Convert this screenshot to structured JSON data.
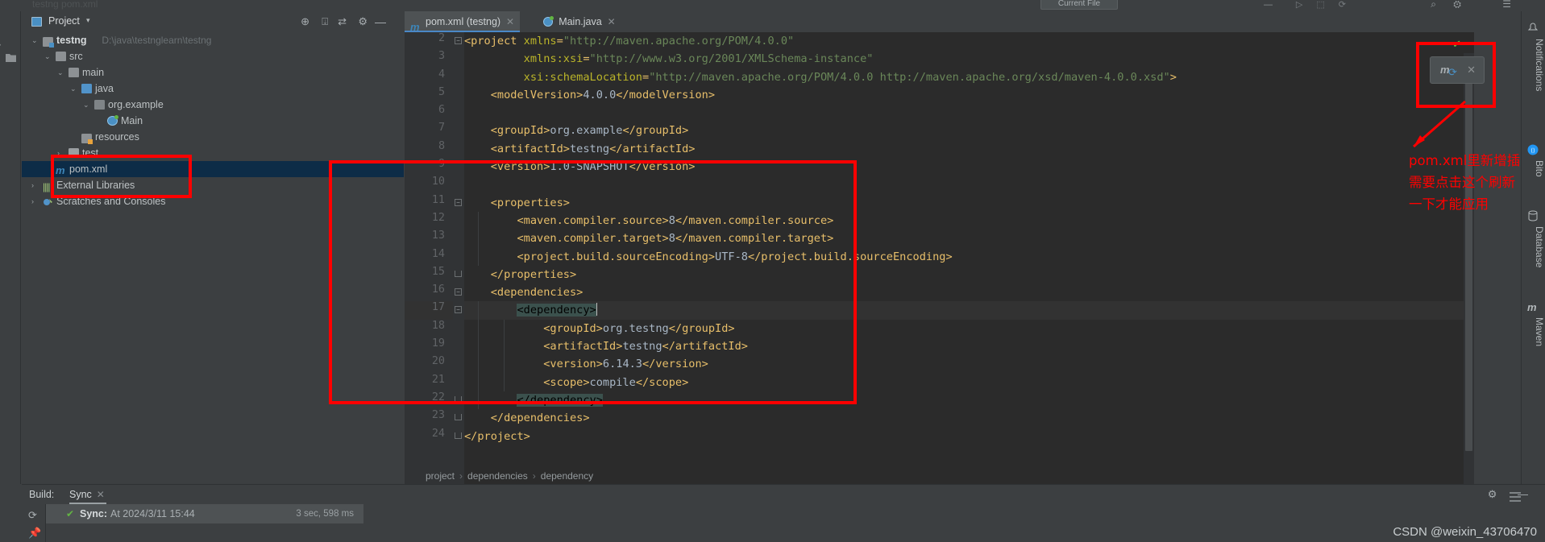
{
  "window": {
    "faint_breadcrumb": "testng    pom.xml",
    "current_file_label": "Current File",
    "minimize": "—",
    "maximize": "□",
    "close": "✕",
    "burger_icon": "burger-menu-icon"
  },
  "left_strip": {
    "project_label": "Project",
    "folder_icon": "folder-icon"
  },
  "project_panel": {
    "title": "Project",
    "chevron": "▾",
    "header_icons": [
      "target-icon",
      "collapse-all-icon",
      "expand-icon",
      "settings-gear-icon",
      "hide-icon"
    ],
    "tree": [
      {
        "indent": 0,
        "arrow": "⌄",
        "icon": "module-folder-icon",
        "label": "testng",
        "path": "D:\\java\\testnglearn\\testng",
        "bold": true,
        "selected": false
      },
      {
        "indent": 1,
        "arrow": "⌄",
        "icon": "folder-icon",
        "label": "src",
        "path": "",
        "bold": false,
        "selected": false
      },
      {
        "indent": 2,
        "arrow": "⌄",
        "icon": "folder-icon",
        "label": "main",
        "path": "",
        "bold": false,
        "selected": false
      },
      {
        "indent": 3,
        "arrow": "⌄",
        "icon": "source-folder-icon",
        "label": "java",
        "path": "",
        "bold": false,
        "selected": false
      },
      {
        "indent": 4,
        "arrow": "⌄",
        "icon": "package-icon",
        "label": "org.example",
        "path": "",
        "bold": false,
        "selected": false
      },
      {
        "indent": 5,
        "arrow": "",
        "icon": "java-class-runnable-icon",
        "label": "Main",
        "path": "",
        "bold": false,
        "selected": false
      },
      {
        "indent": 3,
        "arrow": "",
        "icon": "resources-folder-icon",
        "label": "resources",
        "path": "",
        "bold": false,
        "selected": false
      },
      {
        "indent": 2,
        "arrow": "›",
        "icon": "test-folder-icon",
        "label": "test",
        "path": "",
        "bold": false,
        "selected": false
      },
      {
        "indent": 1,
        "arrow": "",
        "icon": "maven-pom-icon",
        "label": "pom.xml",
        "path": "",
        "bold": false,
        "selected": true
      },
      {
        "indent": 0,
        "arrow": "›",
        "icon": "external-libraries-icon",
        "label": "External Libraries",
        "path": "",
        "bold": false,
        "selected": false
      },
      {
        "indent": 0,
        "arrow": "›",
        "icon": "scratches-icon",
        "label": "Scratches and Consoles",
        "path": "",
        "bold": false,
        "selected": false
      }
    ]
  },
  "editor": {
    "tabs": [
      {
        "icon": "maven-pom-icon",
        "label": "pom.xml (testng)",
        "close": "✕",
        "active": true
      },
      {
        "icon": "java-class-runnable-icon",
        "label": "Main.java",
        "close": "✕",
        "active": false
      }
    ],
    "inspection_status_icon": "ok-check-icon",
    "breadcrumb": [
      "project",
      "dependencies",
      "dependency"
    ],
    "breadcrumb_separator": "›",
    "first_visible_line": 2,
    "lines": [
      {
        "n": 2,
        "fold": "minus",
        "indent": 0,
        "tokens": [
          {
            "t": "tg",
            "v": "<project "
          },
          {
            "t": "at",
            "v": "xmlns"
          },
          {
            "t": "tg",
            "v": "="
          },
          {
            "t": "atv",
            "v": "\"http://maven.apache.org/POM/4.0.0\""
          }
        ]
      },
      {
        "n": 3,
        "fold": "",
        "indent": 0,
        "tokens": [
          {
            "t": "pad",
            "v": "         "
          },
          {
            "t": "at",
            "v": "xmlns:xsi"
          },
          {
            "t": "tg",
            "v": "="
          },
          {
            "t": "atv",
            "v": "\"http://www.w3.org/2001/XMLSchema-instance\""
          }
        ]
      },
      {
        "n": 4,
        "fold": "",
        "indent": 0,
        "tokens": [
          {
            "t": "pad",
            "v": "         "
          },
          {
            "t": "at",
            "v": "xsi:schemaLocation"
          },
          {
            "t": "tg",
            "v": "="
          },
          {
            "t": "atv",
            "v": "\"http://maven.apache.org/POM/4.0.0 http://maven.apache.org/xsd/maven-4.0.0.xsd\""
          },
          {
            "t": "tg",
            "v": ">"
          }
        ]
      },
      {
        "n": 5,
        "fold": "",
        "indent": 0,
        "tokens": [
          {
            "t": "pad",
            "v": "    "
          },
          {
            "t": "tg",
            "v": "<modelVersion>"
          },
          {
            "t": "txt",
            "v": "4.0.0"
          },
          {
            "t": "tg",
            "v": "</modelVersion>"
          }
        ]
      },
      {
        "n": 6,
        "fold": "",
        "indent": 0,
        "tokens": []
      },
      {
        "n": 7,
        "fold": "",
        "indent": 0,
        "tokens": [
          {
            "t": "pad",
            "v": "    "
          },
          {
            "t": "tg",
            "v": "<groupId>"
          },
          {
            "t": "txt",
            "v": "org.example"
          },
          {
            "t": "tg",
            "v": "</groupId>"
          }
        ]
      },
      {
        "n": 8,
        "fold": "",
        "indent": 0,
        "tokens": [
          {
            "t": "pad",
            "v": "    "
          },
          {
            "t": "tg",
            "v": "<artifactId>"
          },
          {
            "t": "txt",
            "v": "testng"
          },
          {
            "t": "tg",
            "v": "</artifactId>"
          }
        ]
      },
      {
        "n": 9,
        "fold": "",
        "indent": 0,
        "tokens": [
          {
            "t": "pad",
            "v": "    "
          },
          {
            "t": "tg",
            "v": "<version>"
          },
          {
            "t": "txt",
            "v": "1.0-SNAPSHOT"
          },
          {
            "t": "tg",
            "v": "</version>"
          }
        ]
      },
      {
        "n": 10,
        "fold": "",
        "indent": 0,
        "tokens": []
      },
      {
        "n": 11,
        "fold": "minus",
        "indent": 0,
        "tokens": [
          {
            "t": "pad",
            "v": "    "
          },
          {
            "t": "tg",
            "v": "<properties>"
          }
        ]
      },
      {
        "n": 12,
        "fold": "",
        "indent": 1,
        "tokens": [
          {
            "t": "pad",
            "v": "        "
          },
          {
            "t": "tg",
            "v": "<maven.compiler.source>"
          },
          {
            "t": "txt",
            "v": "8"
          },
          {
            "t": "tg",
            "v": "</maven.compiler.source>"
          }
        ]
      },
      {
        "n": 13,
        "fold": "",
        "indent": 1,
        "tokens": [
          {
            "t": "pad",
            "v": "        "
          },
          {
            "t": "tg",
            "v": "<maven.compiler.target>"
          },
          {
            "t": "txt",
            "v": "8"
          },
          {
            "t": "tg",
            "v": "</maven.compiler.target>"
          }
        ]
      },
      {
        "n": 14,
        "fold": "",
        "indent": 1,
        "tokens": [
          {
            "t": "pad",
            "v": "        "
          },
          {
            "t": "tg",
            "v": "<project.build.sourceEncoding>"
          },
          {
            "t": "txt",
            "v": "UTF-8"
          },
          {
            "t": "tg",
            "v": "</project.build.sourceEncoding>"
          }
        ]
      },
      {
        "n": 15,
        "fold": "end",
        "indent": 0,
        "tokens": [
          {
            "t": "pad",
            "v": "    "
          },
          {
            "t": "tg",
            "v": "</properties>"
          }
        ]
      },
      {
        "n": 16,
        "fold": "minus",
        "indent": 0,
        "tokens": [
          {
            "t": "pad",
            "v": "    "
          },
          {
            "t": "tg",
            "v": "<dependencies>"
          }
        ]
      },
      {
        "n": 17,
        "fold": "minus",
        "indent": 1,
        "cursor": true,
        "tokens": [
          {
            "t": "pad",
            "v": "        "
          },
          {
            "t": "hl",
            "v": "<dependency>"
          }
        ]
      },
      {
        "n": 18,
        "fold": "",
        "indent": 2,
        "tokens": [
          {
            "t": "pad",
            "v": "            "
          },
          {
            "t": "tg",
            "v": "<groupId>"
          },
          {
            "t": "txt",
            "v": "org.testng"
          },
          {
            "t": "tg",
            "v": "</groupId>"
          }
        ]
      },
      {
        "n": 19,
        "fold": "",
        "indent": 2,
        "tokens": [
          {
            "t": "pad",
            "v": "            "
          },
          {
            "t": "tg",
            "v": "<artifactId>"
          },
          {
            "t": "txt",
            "v": "testng"
          },
          {
            "t": "tg",
            "v": "</artifactId>"
          }
        ]
      },
      {
        "n": 20,
        "fold": "",
        "indent": 2,
        "tokens": [
          {
            "t": "pad",
            "v": "            "
          },
          {
            "t": "tg",
            "v": "<version>"
          },
          {
            "t": "txt",
            "v": "6.14.3"
          },
          {
            "t": "tg",
            "v": "</version>"
          }
        ]
      },
      {
        "n": 21,
        "fold": "",
        "indent": 2,
        "tokens": [
          {
            "t": "pad",
            "v": "            "
          },
          {
            "t": "tg",
            "v": "<scope>"
          },
          {
            "t": "txt",
            "v": "compile"
          },
          {
            "t": "tg",
            "v": "</scope>"
          }
        ]
      },
      {
        "n": 22,
        "fold": "end",
        "indent": 1,
        "tokens": [
          {
            "t": "pad",
            "v": "        "
          },
          {
            "t": "hl",
            "v": "</dependency>"
          }
        ]
      },
      {
        "n": 23,
        "fold": "end",
        "indent": 0,
        "tokens": [
          {
            "t": "pad",
            "v": "    "
          },
          {
            "t": "tg",
            "v": "</dependencies>"
          }
        ]
      },
      {
        "n": 24,
        "fold": "end",
        "indent": 0,
        "tokens": [
          {
            "t": "tg",
            "v": "</project>"
          }
        ]
      }
    ]
  },
  "maven_popup": {
    "icon": "maven-reload-icon",
    "close": "✕"
  },
  "annotation": {
    "line1": "pom.xml里新增插件",
    "line2": "需要点击这个刷新",
    "line3": "一下才能应用",
    "color": "#ff0000"
  },
  "right_strip": {
    "tools": [
      {
        "label": "Notifications",
        "icon": "bell-icon"
      },
      {
        "label": "Bito",
        "icon": "bito-chat-icon"
      },
      {
        "label": "Database",
        "icon": "database-icon"
      },
      {
        "label": "Maven",
        "icon": "maven-icon"
      }
    ]
  },
  "build_panel": {
    "label": "Build:",
    "tab": "Sync",
    "tab_close": "✕",
    "header_icons": [
      "settings-gear-icon",
      "hide-icon"
    ],
    "gutter_icons": [
      "rerun-icon",
      "pin-icon"
    ],
    "row": {
      "status_icon": "green-check-icon",
      "title": "Sync:",
      "detail": "At 2024/3/11 15:44",
      "duration": "3 sec, 598 ms"
    }
  },
  "watermark": "CSDN @weixin_43706470",
  "colors": {
    "accent_blue": "#4a88c7",
    "annotation_red": "#ff0000",
    "selection_blue": "#0d2c47",
    "editor_bg": "#2b2b2b",
    "panel_bg": "#3c3f41",
    "tag_orange": "#e8bf6a",
    "attr_yellow": "#bbb529",
    "value_green": "#6a8759",
    "text_blue": "#a9b7c6",
    "ok_green": "#62b543"
  }
}
